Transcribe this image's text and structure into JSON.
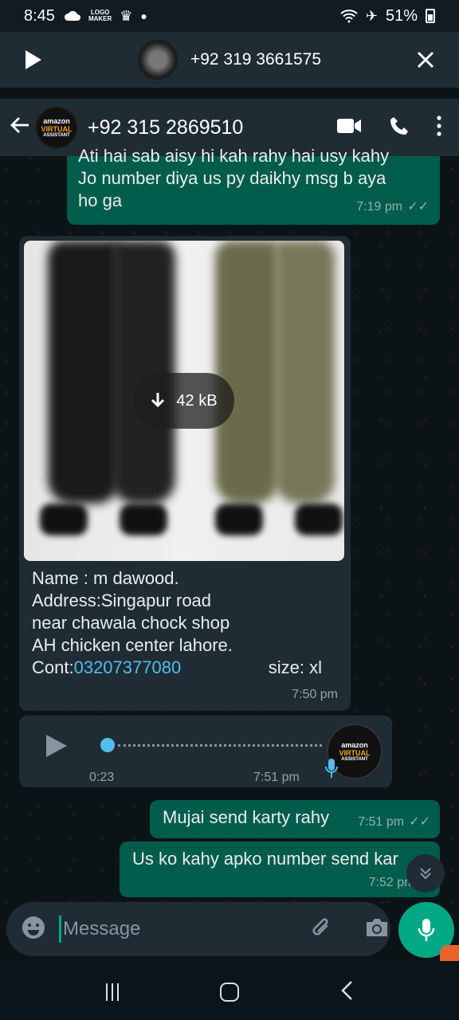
{
  "status_bar": {
    "time": "8:45",
    "badge_line1": "LOGO",
    "badge_line2": "MAKER",
    "battery": "51%"
  },
  "call_banner": {
    "number": "+92 319 3661575"
  },
  "header": {
    "contact_name": "+92 315 2869510",
    "logo_line1": "amazon",
    "logo_line2": "VIRTUAL",
    "logo_line3": "ASSISTANT"
  },
  "messages": [
    {
      "text": "Ati hai sab aisy hi kah rahy hai usy kahy\nJo number diya us py daikhy msg b aya\nho ga",
      "time": "7:19 pm"
    },
    {
      "download_size": "42 kB",
      "caption_line1": "Name : m dawood.",
      "caption_line2": "Address:Singapur road",
      "caption_line3": "near chawala chock shop",
      "caption_line4": "AH chicken center lahore.",
      "caption_cont_label": "Cont:",
      "caption_phone": "03207377080",
      "caption_size": "size: xl",
      "time": "7:50 pm"
    },
    {
      "duration": "0:23",
      "time": "7:51 pm"
    },
    {
      "text": "Mujai send karty rahy",
      "time": "7:51 pm"
    },
    {
      "text": "Us ko kahy apko number send kar",
      "time": "7:52 pm"
    }
  ],
  "input": {
    "placeholder": "Message"
  },
  "colors": {
    "outgoing_bubble": "#005c4b",
    "incoming_bubble": "#1f2c34",
    "accent": "#00a884",
    "link": "#53bdeb"
  }
}
